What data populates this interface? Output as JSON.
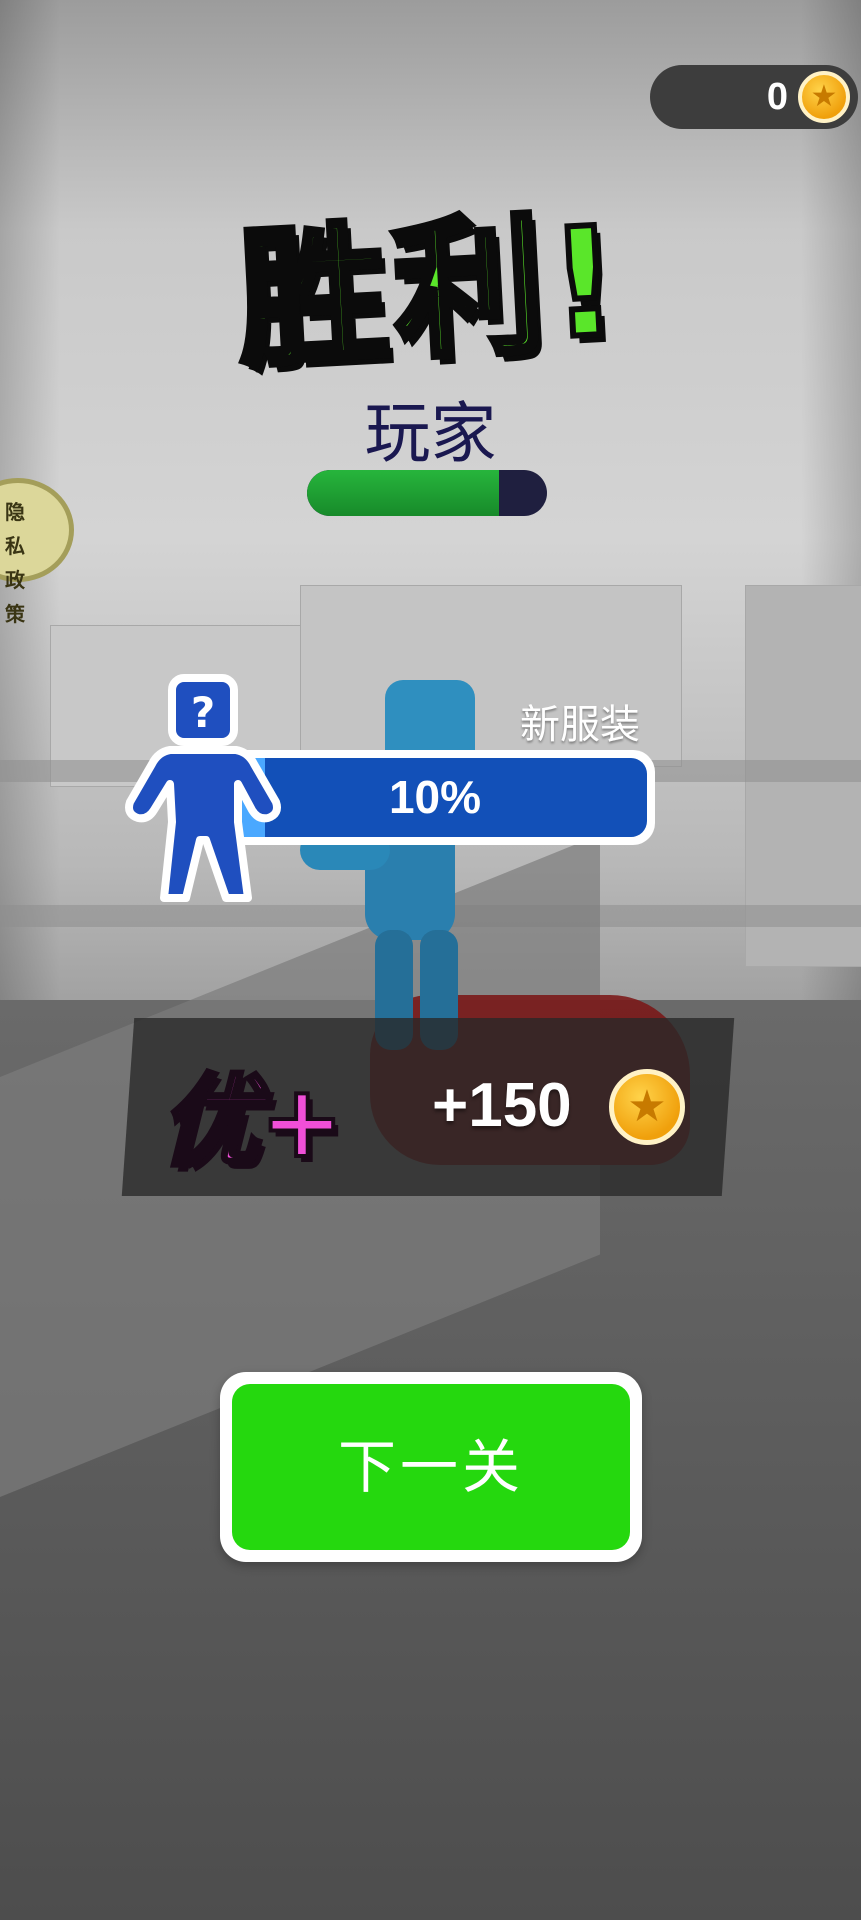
{
  "hud": {
    "coin_count": "0",
    "coin_icon": "coin-star-icon"
  },
  "result": {
    "title": "胜利!",
    "player_name": "玩家",
    "level_progress": 0.8
  },
  "privacy": {
    "label_line1": "隐 私",
    "label_line2": "政 策"
  },
  "outfit": {
    "label": "新服装",
    "progress_text": "10%",
    "progress": 0.1,
    "icon": "mystery-outfit-icon"
  },
  "reward": {
    "grade": "优+",
    "amount": "+150",
    "icon": "coin-star-icon"
  },
  "actions": {
    "next_level_label": "下一关"
  },
  "colors": {
    "title_green": "#5ae62a",
    "button_green": "#25d80e",
    "outfit_blue": "#1250b8",
    "grade_pink": "#f04fd8",
    "coin_gold": "#f0a00c"
  }
}
